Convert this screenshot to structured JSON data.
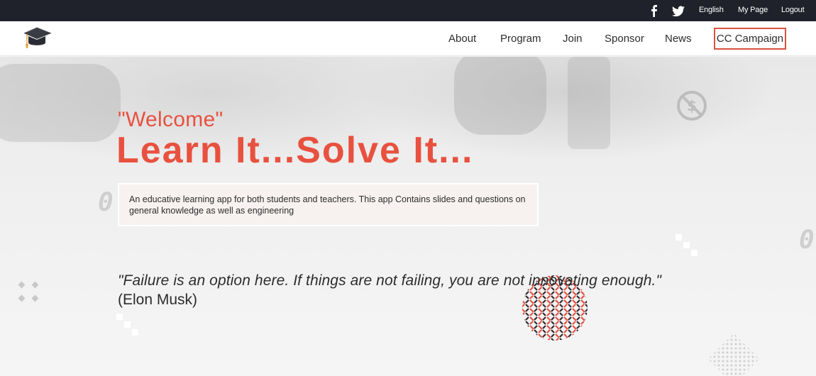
{
  "topbar": {
    "social": [
      "facebook-icon",
      "twitter-icon"
    ],
    "links": {
      "language": "English",
      "my_page": "My Page",
      "logout": "Logout"
    },
    "background": "#20222b"
  },
  "navbar": {
    "logo": "graduation-cap-logo",
    "items": [
      "About",
      "Program",
      "Join",
      "Sponsor",
      "News"
    ],
    "cta": "CC Campaign",
    "cta_border_color": "#d9533f"
  },
  "hero": {
    "welcome": "\"Welcome\"",
    "headline": "Learn It...Solve It...",
    "description": "An educative learning app for both students and teachers. This app Contains slides and questions on general knowledge as well as engineering",
    "quote": "\"Failure is an option here. If things are not failing, you are not innovating enough.\"",
    "author": "(Elon Musk)",
    "accent_color": "#e8513f"
  }
}
